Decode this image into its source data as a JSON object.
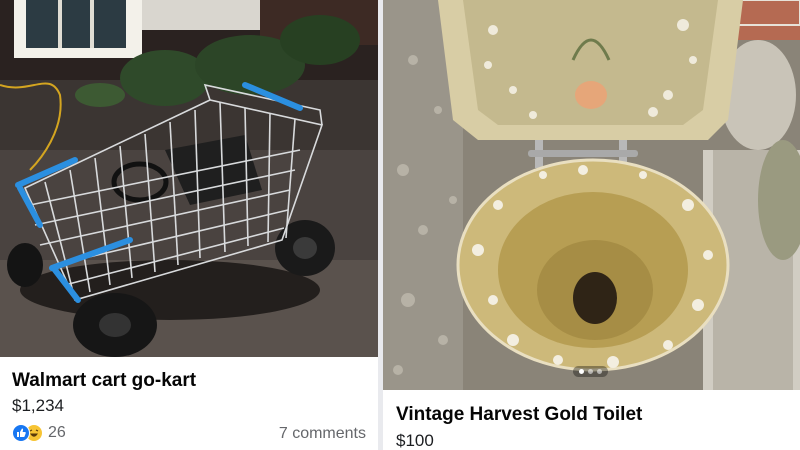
{
  "listings": [
    {
      "title": "Walmart cart go-kart",
      "price": "$1,234",
      "reaction_icons": [
        "like-icon",
        "haha-icon"
      ],
      "reaction_count": "26",
      "comments": "7 comments"
    },
    {
      "title": "Vintage Harvest Gold Toilet",
      "price": "$100"
    }
  ],
  "colors": {
    "like_blue": "#1877f2",
    "haha_yellow": "#f7c434",
    "meta_gray": "#65676b",
    "cart_accent": "#2b8fe0",
    "toilet_gold": "#cdb97a"
  }
}
